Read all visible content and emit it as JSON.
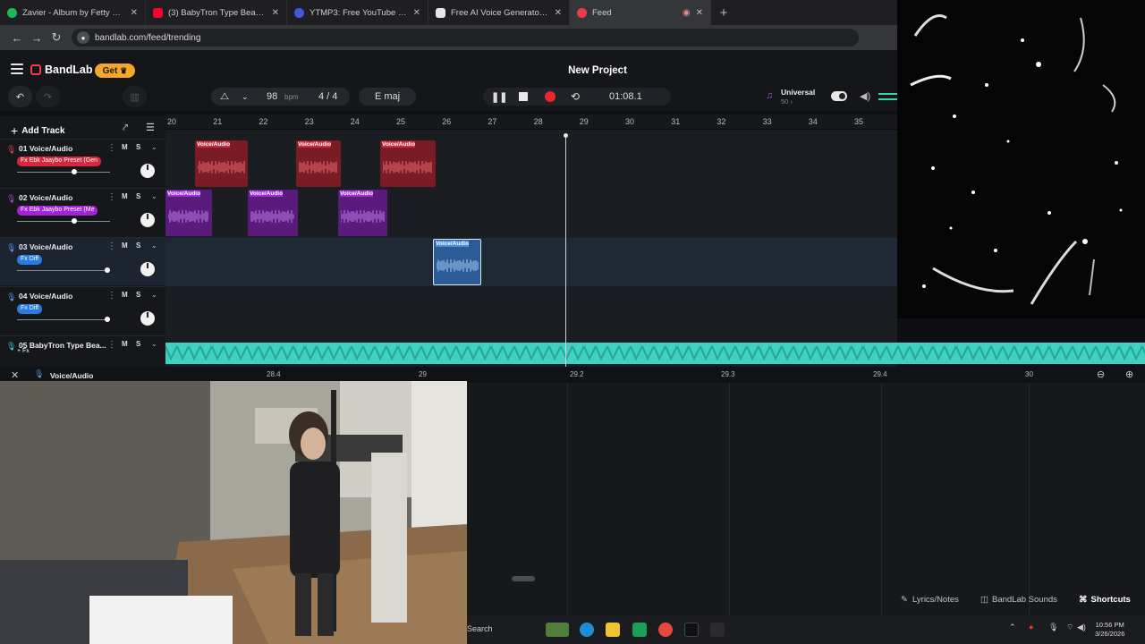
{
  "browser": {
    "tabs": [
      {
        "title": "Zavier - Album by Fetty Wap | Sp",
        "color": "#1db954"
      },
      {
        "title": "(3) BabyTron Type Beat - \"Invasi",
        "color": "#ff0033"
      },
      {
        "title": "YTMP3: Free YouTube to MP3 C",
        "color": "#3b5bdb"
      },
      {
        "title": "Free AI Voice Generator & Voic",
        "color": "#e6e6e6"
      },
      {
        "title": "Feed",
        "color": "#ef3b4a"
      }
    ],
    "url": "bandlab.com/feed/trending"
  },
  "app": {
    "brand": "BandLab",
    "get_label": "Get",
    "project_title": "New Project"
  },
  "transport": {
    "bpm": "98",
    "bpm_unit": "bpm",
    "time_signature": "4 / 4",
    "key": "E maj",
    "time": "01:08.1",
    "preset": "Universal",
    "preset_sub": "50 ›"
  },
  "tracks": {
    "add_label": "Add Track",
    "items": [
      {
        "name": "01  Voice/Audio",
        "fx": "Fx Ebk Jaaybo Preset (Gen",
        "fx_color": "#d7263d",
        "color": "#e0404f",
        "vol": 0.62
      },
      {
        "name": "02  Voice/Audio",
        "fx": "Fx Ebk Jaaybo Preset (Me",
        "fx_color": "#a324d8",
        "color": "#a74bd6",
        "vol": 0.62
      },
      {
        "name": "03  Voice/Audio",
        "fx": "Fx Diff",
        "fx_color": "#2a7be0",
        "color": "#5b9be8",
        "vol": 0.97
      },
      {
        "name": "04  Voice/Audio",
        "fx": "Fx Diff",
        "fx_color": "#2a7be0",
        "color": "#5b9be8",
        "vol": 0.97
      },
      {
        "name": "05  BabyTron Type Bea...",
        "fx": "+ Fx",
        "fx_color": "#2b2d32",
        "color": "#3fd1c4",
        "vol": 0
      }
    ],
    "mute_label": "M",
    "solo_label": "S",
    "clip_label": "Voice/Audio"
  },
  "ruler": {
    "bars": [
      "20",
      "21",
      "22",
      "23",
      "24",
      "25",
      "26",
      "27",
      "28",
      "29",
      "30",
      "31",
      "32",
      "33",
      "34",
      "35"
    ]
  },
  "editor": {
    "track_label": "Voice/Audio",
    "ticks": [
      "28.4",
      "29",
      "29.2",
      "29.3",
      "29.4",
      "30"
    ]
  },
  "footer": {
    "lyrics": "Lyrics/Notes",
    "sounds": "BandLab Sounds",
    "shortcuts": "Shortcuts"
  },
  "taskbar": {
    "search": "Search",
    "time": "10:56 PM",
    "date": "3/26/2026"
  }
}
